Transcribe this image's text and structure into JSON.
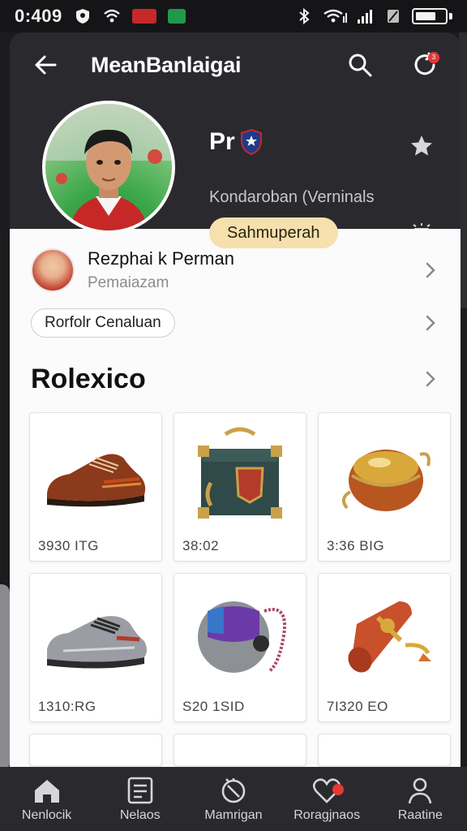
{
  "status_bar": {
    "time": "0:409",
    "icons": [
      "shield-status-icon",
      "wifi-icon",
      "red-app-icon",
      "green-app-icon",
      "bluetooth-icon",
      "wifi-signal-icon",
      "cell-signal-icon",
      "sim-icon",
      "battery-icon"
    ]
  },
  "header": {
    "title": "MeanBanlaigai",
    "back_icon": "arrow-left-icon",
    "search_icon": "search-icon",
    "notification_icon": "refresh-notification-icon",
    "notification_count": "3"
  },
  "profile": {
    "name": "Pr",
    "subtitle": "Kondaroban (Verninals",
    "subscribe_label": "Sahmuperah",
    "star_icon": "star-icon",
    "lamp_icon": "lamp-icon"
  },
  "user_row": {
    "name": "Rezphai k Perman",
    "handle": "Pemaiazam"
  },
  "chip": {
    "label": "Rorfolr Cenaluan"
  },
  "section": {
    "title": "Rolexico"
  },
  "products": [
    {
      "price": "3930 ITG",
      "icon": "leather-shoe-icon"
    },
    {
      "price": "38:02",
      "icon": "treasure-chest-icon"
    },
    {
      "price": "3:36 BIG",
      "icon": "golden-pot-icon"
    },
    {
      "price": "1310:RG",
      "icon": "sneaker-icon"
    },
    {
      "price": "S20 1SID",
      "icon": "metal-orb-icon"
    },
    {
      "price": "7I320 EO",
      "icon": "scroll-bundle-icon"
    }
  ],
  "bottom_nav": [
    {
      "label": "Nenlocik",
      "icon": "home-icon"
    },
    {
      "label": "Nelaos",
      "icon": "list-icon"
    },
    {
      "label": "Mamrigan",
      "icon": "compass-icon"
    },
    {
      "label": "Roragjnaos",
      "icon": "heart-icon"
    },
    {
      "label": "Raatine",
      "icon": "user-icon"
    }
  ],
  "colors": {
    "header_bg": "#2a2a2e",
    "accent_pill": "#f5e0ae",
    "badge_red": "#e53935"
  }
}
